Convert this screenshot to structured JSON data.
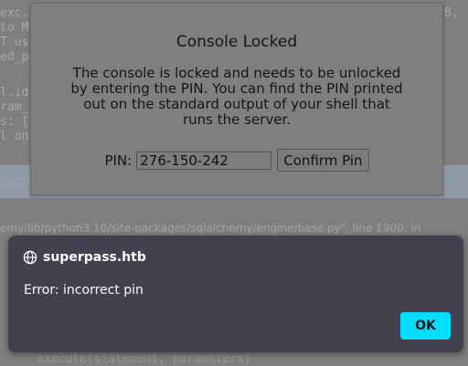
{
  "background": {
    "code_lines": [
      "exc.",
      "to M",
      "T us",
      "ed_pa",
      "l.id",
      "ram_",
      "s: {'",
      "l on"
    ],
    "band_text": "most",
    "file_line": {
      "prefix": "emy/lib/python3.10/site-packages/sqlalchemy/engine/base.py\", line ",
      "number": "1900",
      "suffix": ", in"
    },
    "right_fragment": "8,  (",
    "bottom_line": "execute(statement, parameters)"
  },
  "dialog": {
    "title": "Console Locked",
    "message": "The console is locked and needs to be unlocked by entering the PIN. You can find the PIN printed out on the standard output of your shell that runs the server.",
    "pin_label": "PIN:",
    "pin_value": "276-150-242",
    "confirm_label": "Confirm Pin"
  },
  "alert": {
    "site": "superpass.htb",
    "message": "Error: incorrect pin",
    "ok_label": "OK",
    "ok_color": "#00ddff",
    "background_color": "#42414d"
  }
}
